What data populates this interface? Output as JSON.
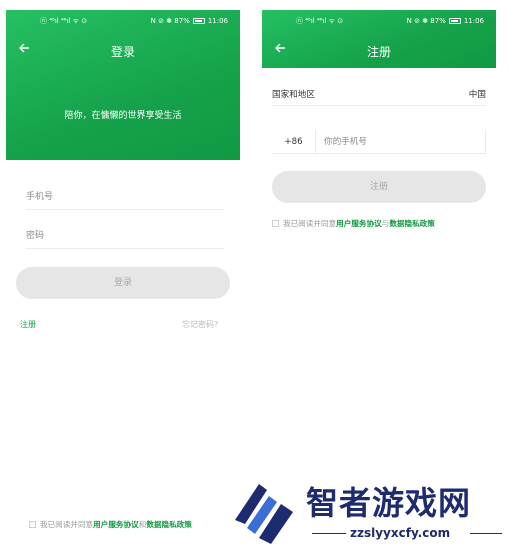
{
  "status_bar": {
    "left": "ⓝ ⁴⁶ıl ⁴⁶ıl ᯤ ⊙",
    "right": "N ⊘ ✱ 87%",
    "time": "11:06"
  },
  "login": {
    "title": "登录",
    "slogan": "陪你，在慵懒的世界享受生活",
    "phone_placeholder": "手机号",
    "password_placeholder": "密码",
    "login_button": "登录",
    "register_link": "注册",
    "forgot_link": "忘记密码?",
    "agree_prefix": "我已阅读并同意",
    "agree_terms": "用户服务协议",
    "agree_and": "和",
    "agree_privacy": "数据隐私政策"
  },
  "register": {
    "title": "注册",
    "region_label": "国家和地区",
    "region_value": "中国",
    "country_code": "+86",
    "phone_placeholder": "你的手机号",
    "register_button": "注册",
    "agree_prefix": "我已阅读并同意",
    "agree_terms": "用户服务协议",
    "agree_and": "与",
    "agree_privacy": "数据隐私政策"
  },
  "watermark": {
    "title": "智者游戏网",
    "url": "zzslyyxcfy.com"
  },
  "colors": {
    "brand_green": "#18a04b",
    "button_gray": "#e6e6e6",
    "watermark_navy": "#1e2b6e"
  }
}
